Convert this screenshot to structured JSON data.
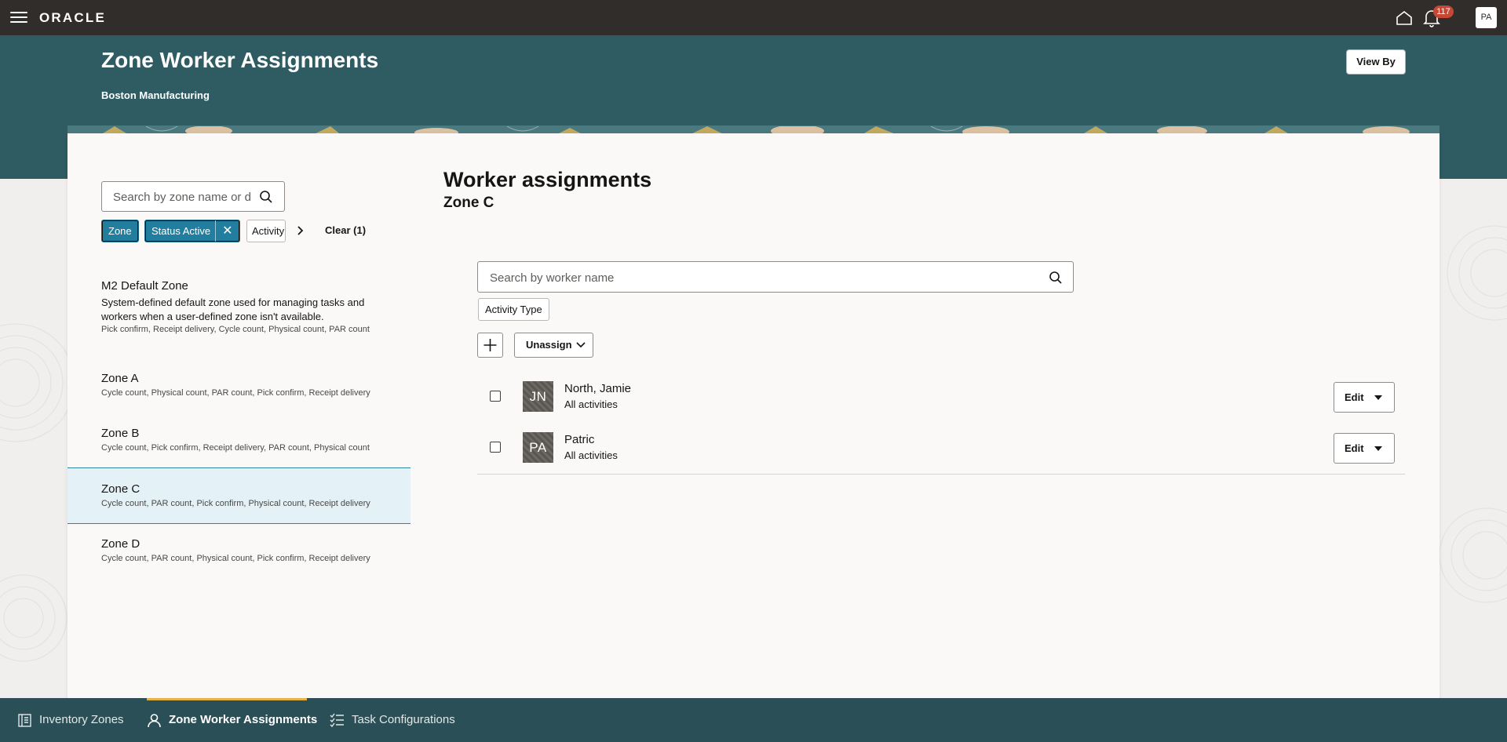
{
  "app": {
    "brand": "ORACLE",
    "notification_count": "117",
    "user_initials": "PA"
  },
  "header": {
    "title": "Zone Worker Assignments",
    "subtitle": "Boston Manufacturing",
    "view_by_label": "View By"
  },
  "zones_panel": {
    "search_placeholder": "Search by zone name or description",
    "filters": [
      {
        "label": "Zone",
        "active": true
      },
      {
        "label": "Status Active",
        "active": true,
        "removable": true
      },
      {
        "label": "Activity",
        "active": false
      }
    ],
    "clear_label": "Clear (1)",
    "zones": [
      {
        "name": "M2 Default Zone",
        "description": "System-defined default zone used for managing tasks and workers when a user-defined zone isn't available.",
        "activities": "Pick confirm, Receipt delivery, Cycle count, Physical count, PAR count"
      },
      {
        "name": "Zone A",
        "description": "",
        "activities": "Cycle count, Physical count, PAR count, Pick confirm, Receipt delivery"
      },
      {
        "name": "Zone B",
        "description": "",
        "activities": "Cycle count, Pick confirm, Receipt delivery, PAR count, Physical count"
      },
      {
        "name": "Zone C",
        "description": "",
        "activities": "Cycle count, PAR count, Pick confirm, Physical count, Receipt delivery",
        "selected": true
      },
      {
        "name": "Zone D",
        "description": "",
        "activities": "Cycle count, PAR count, Physical count, Pick confirm, Receipt delivery"
      }
    ]
  },
  "assignments": {
    "title": "Worker assignments",
    "zone": "Zone C",
    "search_placeholder": "Search by worker name",
    "filter_label": "Activity Type",
    "unassign_label": "Unassign",
    "workers": [
      {
        "initials": "JN",
        "name": "North, Jamie",
        "activities": "All activities",
        "edit_label": "Edit"
      },
      {
        "initials": "PA",
        "name": "Patric",
        "activities": "All activities",
        "edit_label": "Edit"
      }
    ]
  },
  "bottom_nav": {
    "items": [
      {
        "label": "Inventory Zones",
        "icon": "book-icon"
      },
      {
        "label": "Zone Worker Assignments",
        "icon": "person-icon",
        "active": true
      },
      {
        "label": "Task Configurations",
        "icon": "checklist-icon"
      }
    ]
  },
  "colors": {
    "topbar": "#312d2a",
    "header_band": "#2f5b63",
    "chip_active": "#227e9e",
    "selected_row": "#e4f1f7",
    "nav_indicator": "#e5b34a",
    "badge": "#c74634"
  }
}
